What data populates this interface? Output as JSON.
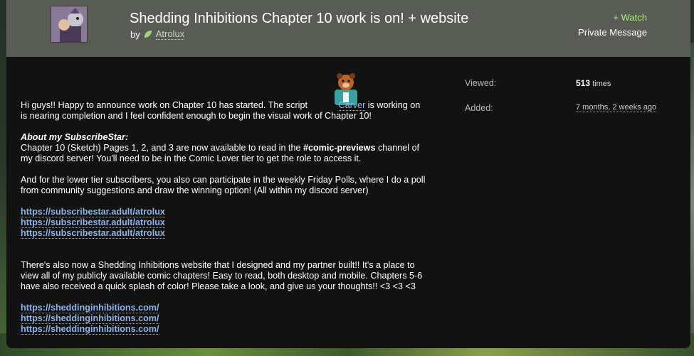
{
  "submission": {
    "title": "Shedding Inhibitions Chapter 10 work is on! + website",
    "by_label": "by",
    "author": "Atrolux",
    "watch_label": "+ Watch",
    "private_message_label": "Private Message"
  },
  "stats": {
    "viewed_label": "Viewed:",
    "viewed_count": "513",
    "viewed_unit": "times",
    "added_label": "Added:",
    "added_value": "7 months, 2 weeks ago"
  },
  "description": {
    "intro_before": "Hi guys!! Happy to announce work on Chapter 10 has started. The script ",
    "intro_user": "Carver",
    "intro_after_line1": " is working on",
    "intro_line2": "is nearing completion and I feel confident enough to begin the visual work of Chapter 10!",
    "heading": "About my SubscribeStar:",
    "para1_before": "Chapter 10 (Sketch) Pages 1, 2, and 3 are now available to read in the ",
    "para1_channel": "#comic-previews",
    "para1_after": " channel of",
    "para1_line2": "my discord server! You'll need to be in the Comic Lover tier to get the role to access it.",
    "para2_line1": "And for the lower tier subscribers, you also can participate in the weekly Friday Polls, where I do a poll",
    "para2_line2": "from community suggestions and draw the winning option! (All within my discord server)",
    "subscribestar_links": [
      "https://subscribestar.adult/atrolux",
      "https://subscribestar.adult/atrolux",
      "https://subscribestar.adult/atrolux"
    ],
    "para3_line1": "There's also now a Shedding Inhibitions website that I designed and my partner built!! It's a place to",
    "para3_line2": "view all of my publicly available comic chapters! Easy to read, both desktop and mobile. Chapters 5-6",
    "para3_line3": "have also received a quick splash of color! Please take a look, and give us your thoughts!! <3 <3 <3",
    "website_links": [
      "https://sheddinginhibitions.com/",
      "https://sheddinginhibitions.com/",
      "https://sheddinginhibitions.com/"
    ]
  },
  "colors": {
    "header_bg": "#595c55",
    "content_bg": "#121212",
    "link": "#8db4e8",
    "watch": "#a6f27a"
  },
  "icons": [
    "author-leaf-icon",
    "author-avatar",
    "carver-avatar"
  ]
}
